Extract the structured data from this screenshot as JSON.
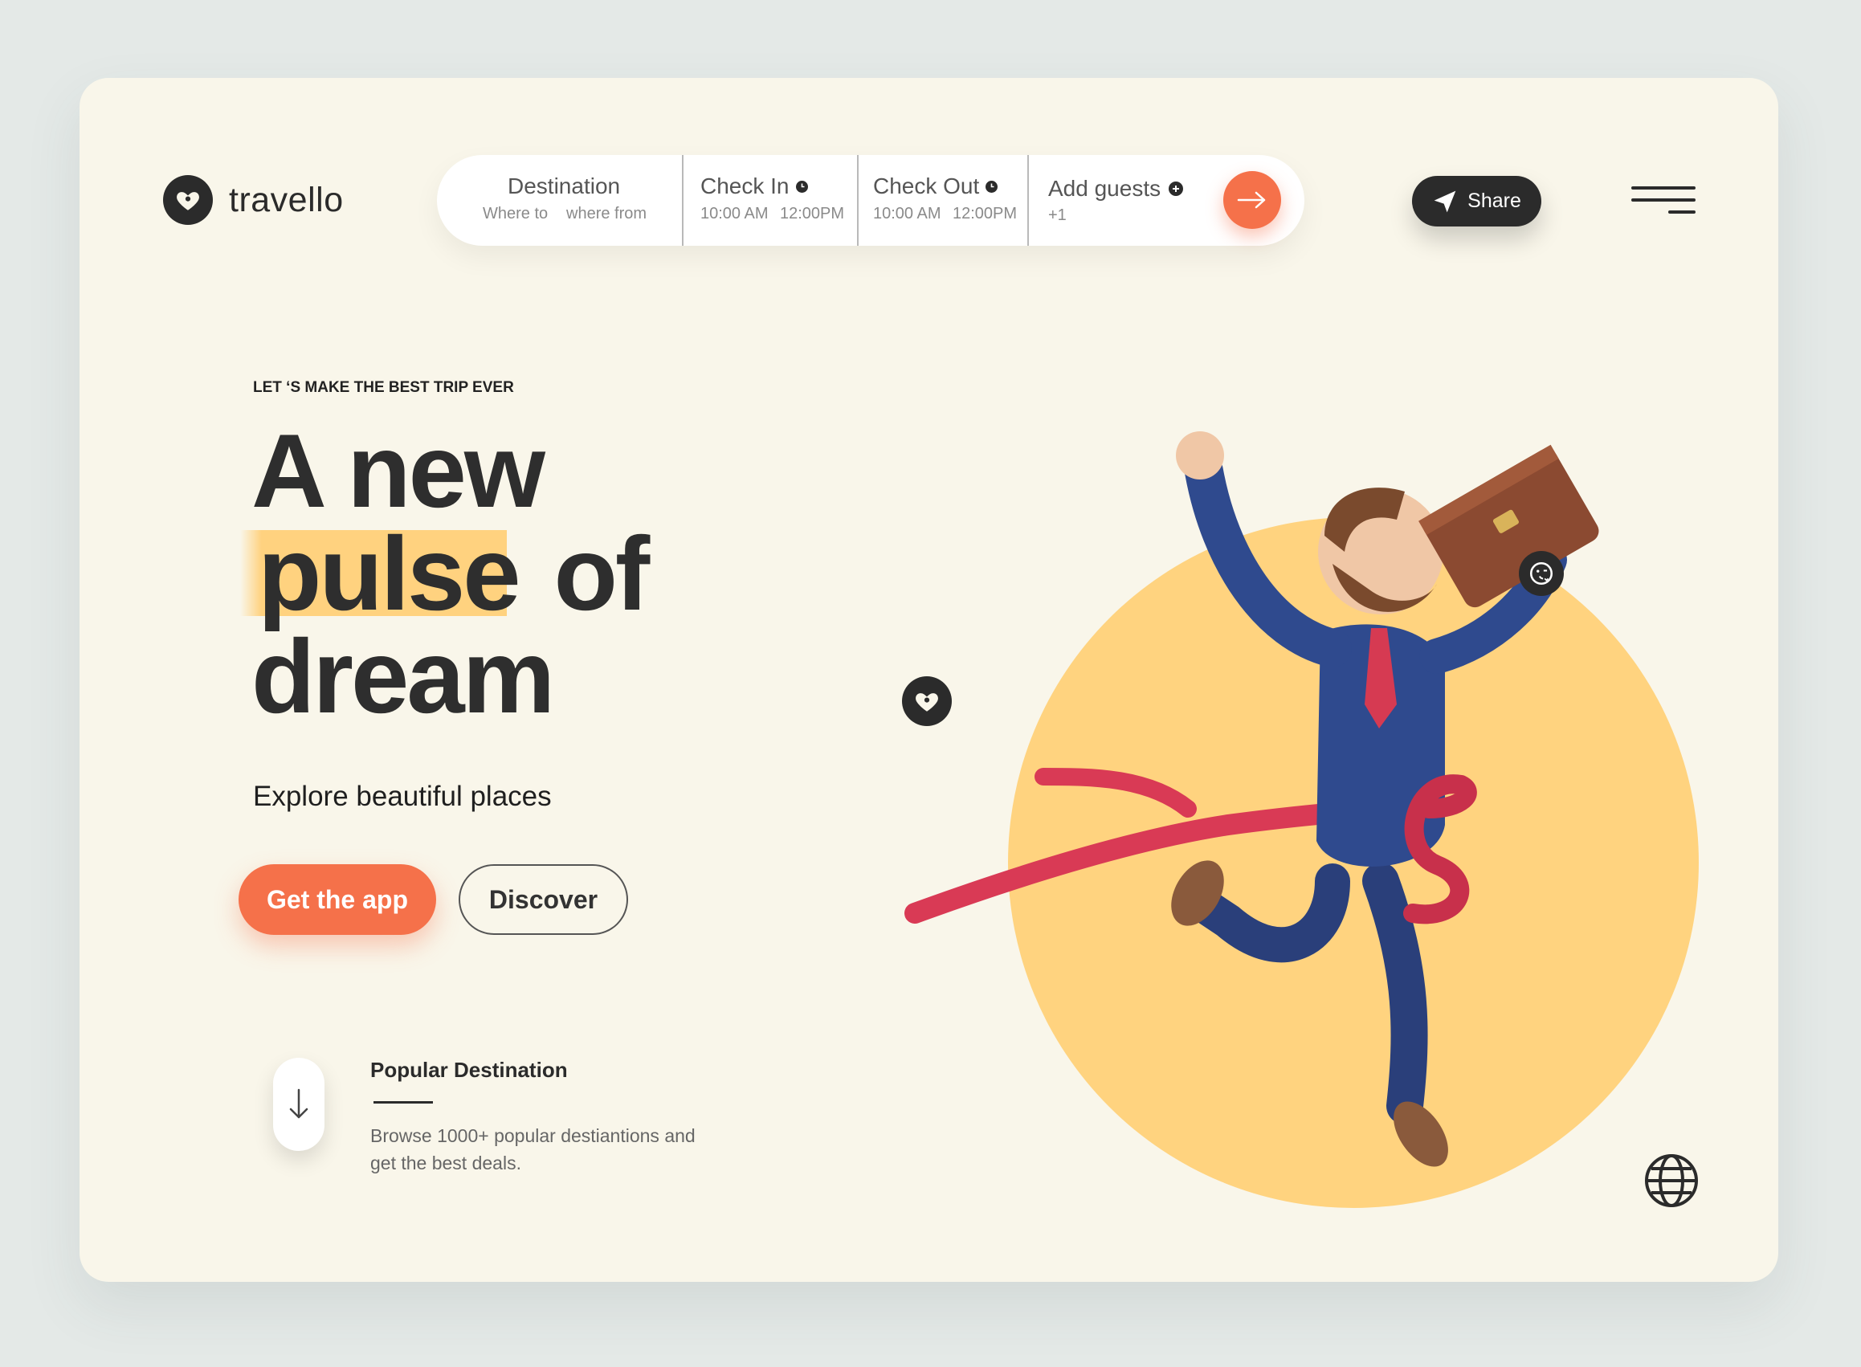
{
  "brand": {
    "name": "travello"
  },
  "search": {
    "destination": {
      "label": "Destination",
      "sub_from": "Where to",
      "sub_to": "where from"
    },
    "check_in": {
      "label": "Check In",
      "time_start": "10:00 AM",
      "time_end": "12:00PM"
    },
    "check_out": {
      "label": "Check Out",
      "time_start": "10:00 AM",
      "time_end": "12:00PM"
    },
    "guests": {
      "label": "Add guests",
      "count": "+1"
    }
  },
  "header": {
    "share_label": "Share"
  },
  "hero": {
    "eyebrow": "LET ‘S MAKE THE BEST TRIP EVER",
    "headline_line1": "A new",
    "headline_highlight": "pulse",
    "headline_of": "of",
    "headline_line3": "dream",
    "subhead": "Explore beautiful places",
    "primary_cta": "Get the app",
    "secondary_cta": "Discover"
  },
  "popular": {
    "title": "Popular Destination",
    "description": "Browse 1000+ popular destiantions and get the best deals."
  },
  "colors": {
    "accent": "#f5714a",
    "dark": "#2b2b2b",
    "highlight": "#ffd27f",
    "card_bg": "#f9f6ea",
    "circle": "#ffd37f"
  },
  "icons": [
    "heart-pin-icon",
    "clock-icon",
    "plus-icon",
    "arrow-right-icon",
    "send-icon",
    "menu-icon",
    "arrow-down-icon",
    "emoji-icon",
    "globe-icon"
  ]
}
